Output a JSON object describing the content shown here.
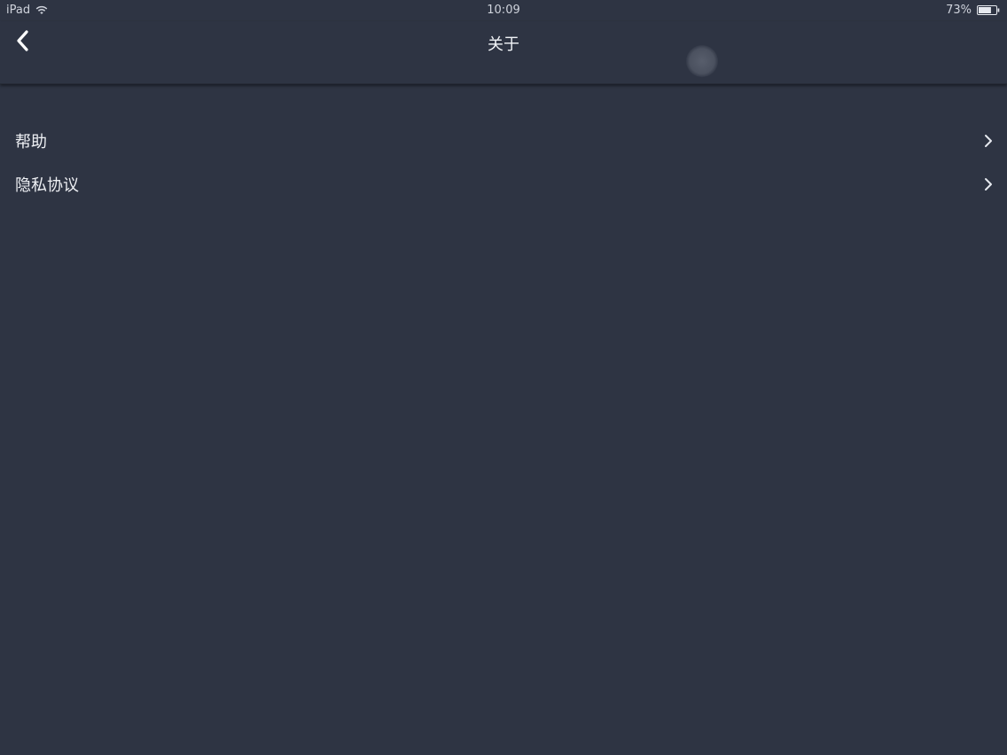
{
  "status_bar": {
    "device": "iPad",
    "time": "10:09",
    "battery": "73%",
    "battery_level": 0.73
  },
  "nav": {
    "title": "关于",
    "back_icon": "chevron-left-icon"
  },
  "list": {
    "items": [
      {
        "label": "帮助",
        "icon": "chevron-right-icon"
      },
      {
        "label": "隐私协议",
        "icon": "chevron-right-icon"
      }
    ]
  },
  "colors": {
    "background": "#2e3443",
    "text": "#eef0f4"
  }
}
